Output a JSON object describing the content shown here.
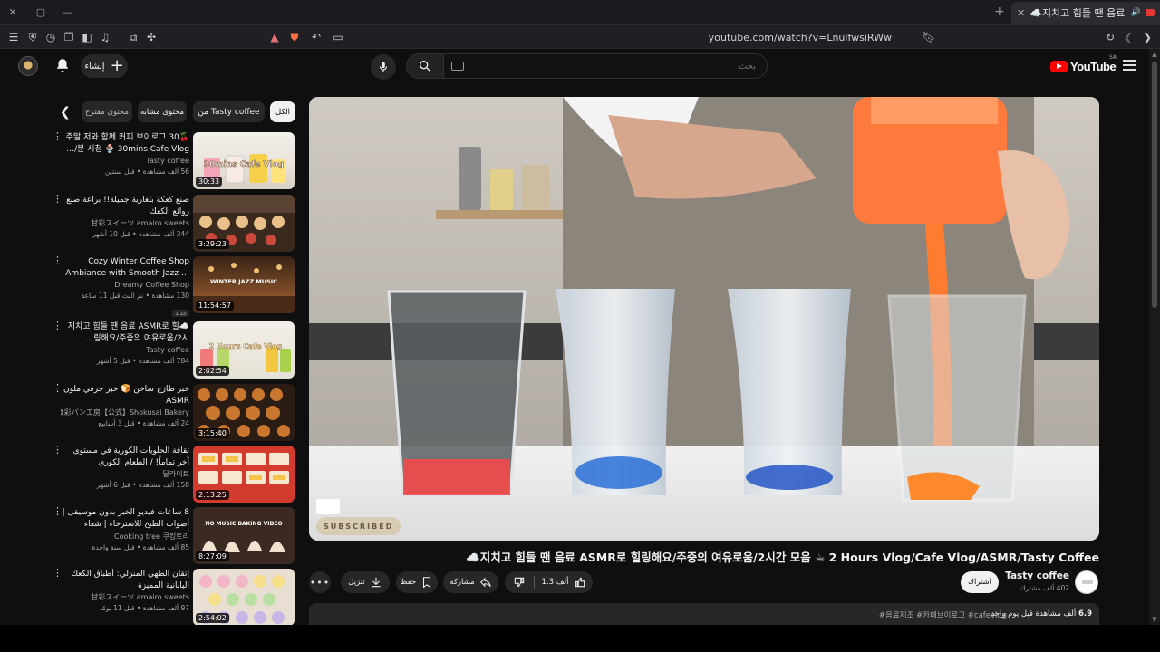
{
  "browser": {
    "tab_title": "☁️지치고 힘들 땐 음료 ASMR로 힐링해요/주중의 여유로움/2시간 모음 ☕ 2 Hours Vlog/Cafe Vlog/ASMR/Tasty Coffee",
    "tab_title_short": "☁️지치고 힘들 땐 음료 ASMR",
    "url": "youtube.com/watch?v=LnulfwsiRWw"
  },
  "header": {
    "create_label": "إنشاء",
    "search_placeholder": "بحث",
    "logo_text": "YouTube",
    "logo_country": "SA"
  },
  "chips": {
    "all": "الكل",
    "from_channel": "من Tasty coffee",
    "related": "محتوى مشابه",
    "recommended": "محتوى مقترح"
  },
  "related": [
    {
      "title": "🍒주말 저와 함께 커피 브이로그 30분 시청 🍨 30mins Cafe Vlog/…",
      "channel": "Tasty coffee",
      "stats": "56 ألف مشاهدة • قبل سنتين",
      "duration": "30:33",
      "thumb_text": "30mins Cafe Vlog"
    },
    {
      "title": "صنع كعكة بلغارية جميلة!! براعة صنع روائع الكعك",
      "channel": "甘彩スイーツ amairo sweets",
      "stats": "344 ألف مشاهدة • قبل 10 أشهر",
      "duration": "3:29:23",
      "thumb_text": ""
    },
    {
      "title": "Cozy Winter Coffee Shop Ambiance with Smooth Jazz …",
      "channel": "Dreamy Coffee Shop",
      "stats": "130 مشاهدة • تم البث قبل 11 ساعة",
      "badge": "جديد",
      "duration": "11:54:57",
      "thumb_text": "WINTER JAZZ MUSIC"
    },
    {
      "title": "☁️지치고 힘들 땐 음료 ASMR로 힐링해요/주중의 여유로움/2시…",
      "channel": "Tasty coffee",
      "stats": "784 ألف مشاهدة • قبل 5 أشهر",
      "duration": "2:02:54",
      "thumb_text": "2 Hours Cafe Vlog"
    },
    {
      "title": "خبز طازج ساخن 🍞 خبز حرفي ملون ASMR",
      "channel": "食彩パン工房【公式】Shokusai Bakery …",
      "stats": "24 ألف مشاهدة • قبل 3 أسابيع",
      "duration": "3:15:40",
      "thumb_text": ""
    },
    {
      "title": "ثقافة الحلويات الكورية في مستوى آخر تماماً! / الطعام الكوري",
      "channel": "달라이트",
      "stats": "158 ألف مشاهدة • قبل 6 أشهر",
      "duration": "2:13:25",
      "thumb_text": ""
    },
    {
      "title": "8 ساعات فيديو الخبز بدون موسيقى | أصوات الطبخ للاسترخاء | شعاء أصوات النوم",
      "channel": "Cooking tree 쿠킹트리",
      "stats": "85 ألف مشاهدة • قبل سنة واحدة",
      "duration": "8:27:09",
      "thumb_text": "NO MUSIC BAKING VIDEO"
    },
    {
      "title": "إتقان الطهي المنزلي: أطباق الكعك اليابانية المميزة",
      "channel": "甘彩スイーツ amairo sweets",
      "stats": "97 ألف مشاهدة • قبل 11 يومًا",
      "duration": "2:54:02",
      "thumb_text": ""
    }
  ],
  "video": {
    "title": "☁️지치고 힘들 땐 음료 ASMR로 힐링해요/주중의 여유로움/2시간 모음 ☕ 2 Hours Vlog/Cafe Vlog/ASMR/Tasty Coffee",
    "watermark": "SUBSCRIBED",
    "channel_name": "Tasty coffee",
    "channel_subs": "402 ألف مشترك",
    "subscribe_label": "اشتراك",
    "likes": "1.3 ألف",
    "share_label": "مشاركة",
    "save_label": "حفظ",
    "download_label": "تنزيل",
    "views_count": "6.9",
    "views_rest": " ألف مشاهدة قبل يوم واحد",
    "tags": "#음료제조 #카페브이로그 #cafevlog"
  },
  "colors": {
    "background": "#0f0f0f",
    "chip": "#272727",
    "brand_red": "#ff0000"
  }
}
